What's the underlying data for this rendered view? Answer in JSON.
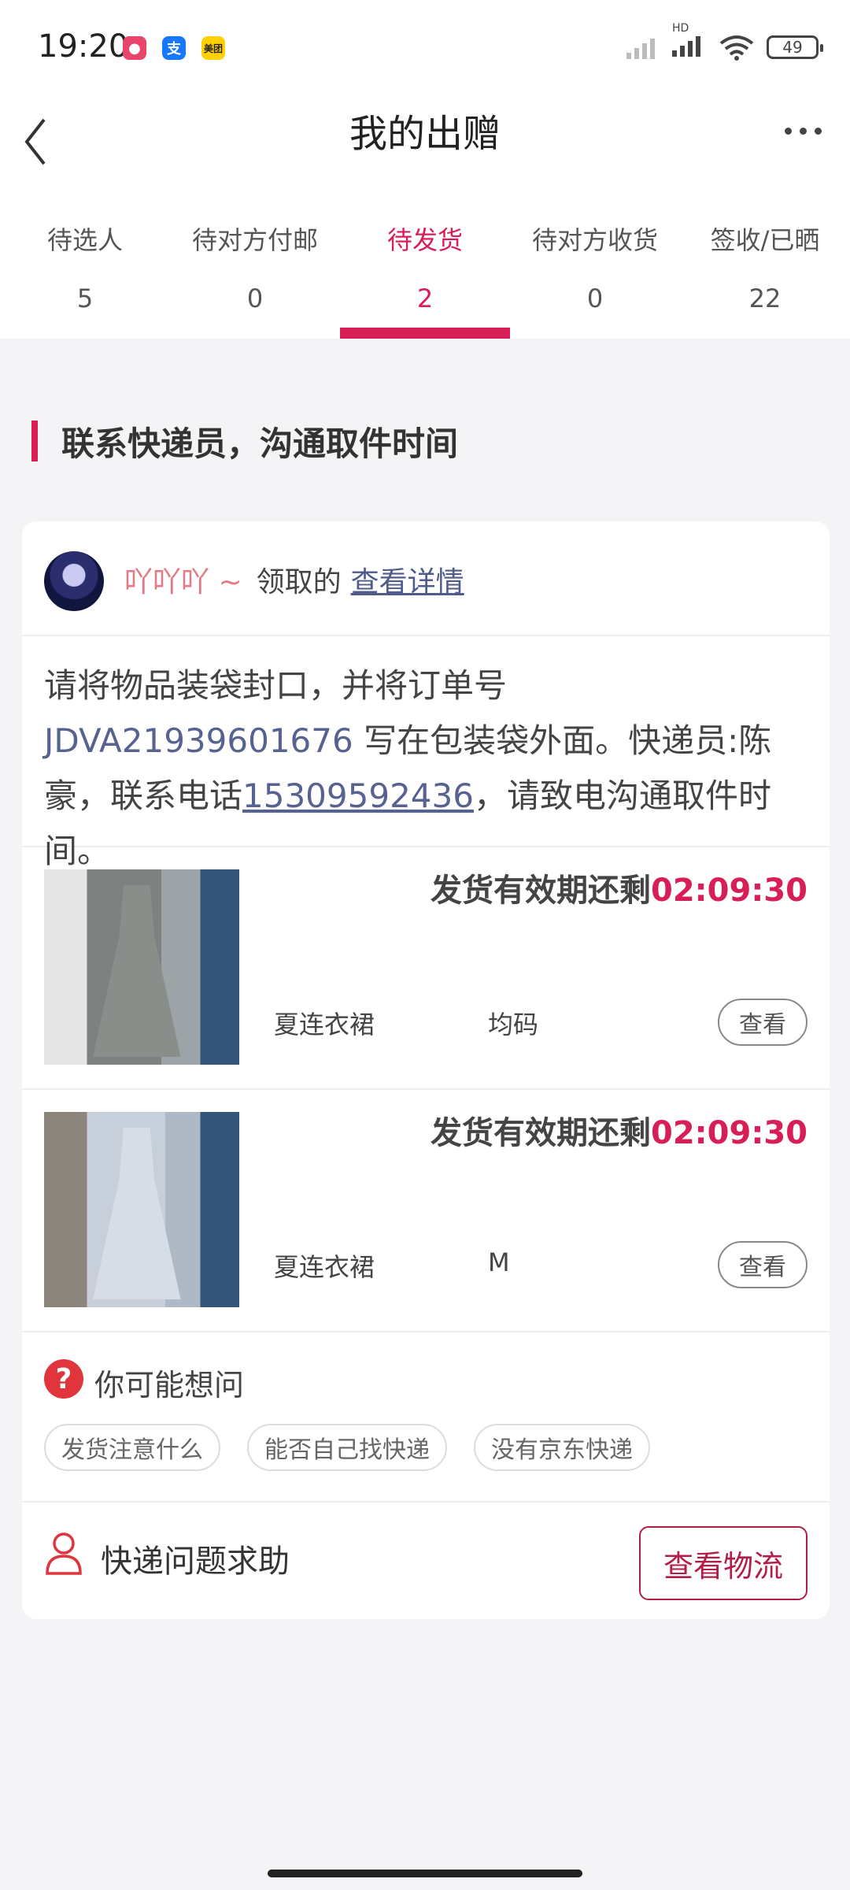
{
  "status_bar": {
    "time": "19:20",
    "network_label": "HD",
    "battery": "49",
    "app_icons": [
      {
        "name": "app-icon",
        "color": "#e8456b"
      },
      {
        "name": "alipay-icon",
        "glyph": "支",
        "color": "#1677ff"
      },
      {
        "name": "meituan-icon",
        "glyph": "美团",
        "color": "#ffd100"
      }
    ]
  },
  "header": {
    "title": "我的出赠"
  },
  "tabs": [
    {
      "label": "待选人",
      "count": "5",
      "active": false
    },
    {
      "label": "待对方付邮",
      "count": "0",
      "active": false
    },
    {
      "label": "待发货",
      "count": "2",
      "active": true
    },
    {
      "label": "待对方收货",
      "count": "0",
      "active": false
    },
    {
      "label": "签收/已晒",
      "count": "22",
      "active": false
    }
  ],
  "section_title": "联系快递员，沟通取件时间",
  "card": {
    "user": {
      "name": "吖吖吖 ~",
      "action": "领取的",
      "detail_link": "查看详情"
    },
    "instructions": {
      "part1": "请将物品装袋封口，并将订单号 ",
      "order_no": "JDVA21939601676",
      "part2": " 写在包装袋外面。快递员:陈豪，联系电话",
      "phone": "15309592436",
      "part3": "，请致电沟通取件时间。"
    },
    "items": [
      {
        "deadline_label": "发货有效期还剩",
        "timer": "02:09:30",
        "name": "夏连衣裙",
        "size": "均码",
        "view_label": "查看"
      },
      {
        "deadline_label": "发货有效期还剩",
        "timer": "02:09:30",
        "name": "夏连衣裙",
        "size": "M",
        "view_label": "查看"
      }
    ],
    "faq": {
      "title": "你可能想问",
      "icon_glyph": "?",
      "chips": [
        "发货注意什么",
        "能否自己找快递",
        "没有京东快递"
      ]
    },
    "help": {
      "label": "快递问题求助",
      "button": "查看物流"
    }
  },
  "colors": {
    "accent": "#d81e57",
    "link": "#56628f"
  }
}
